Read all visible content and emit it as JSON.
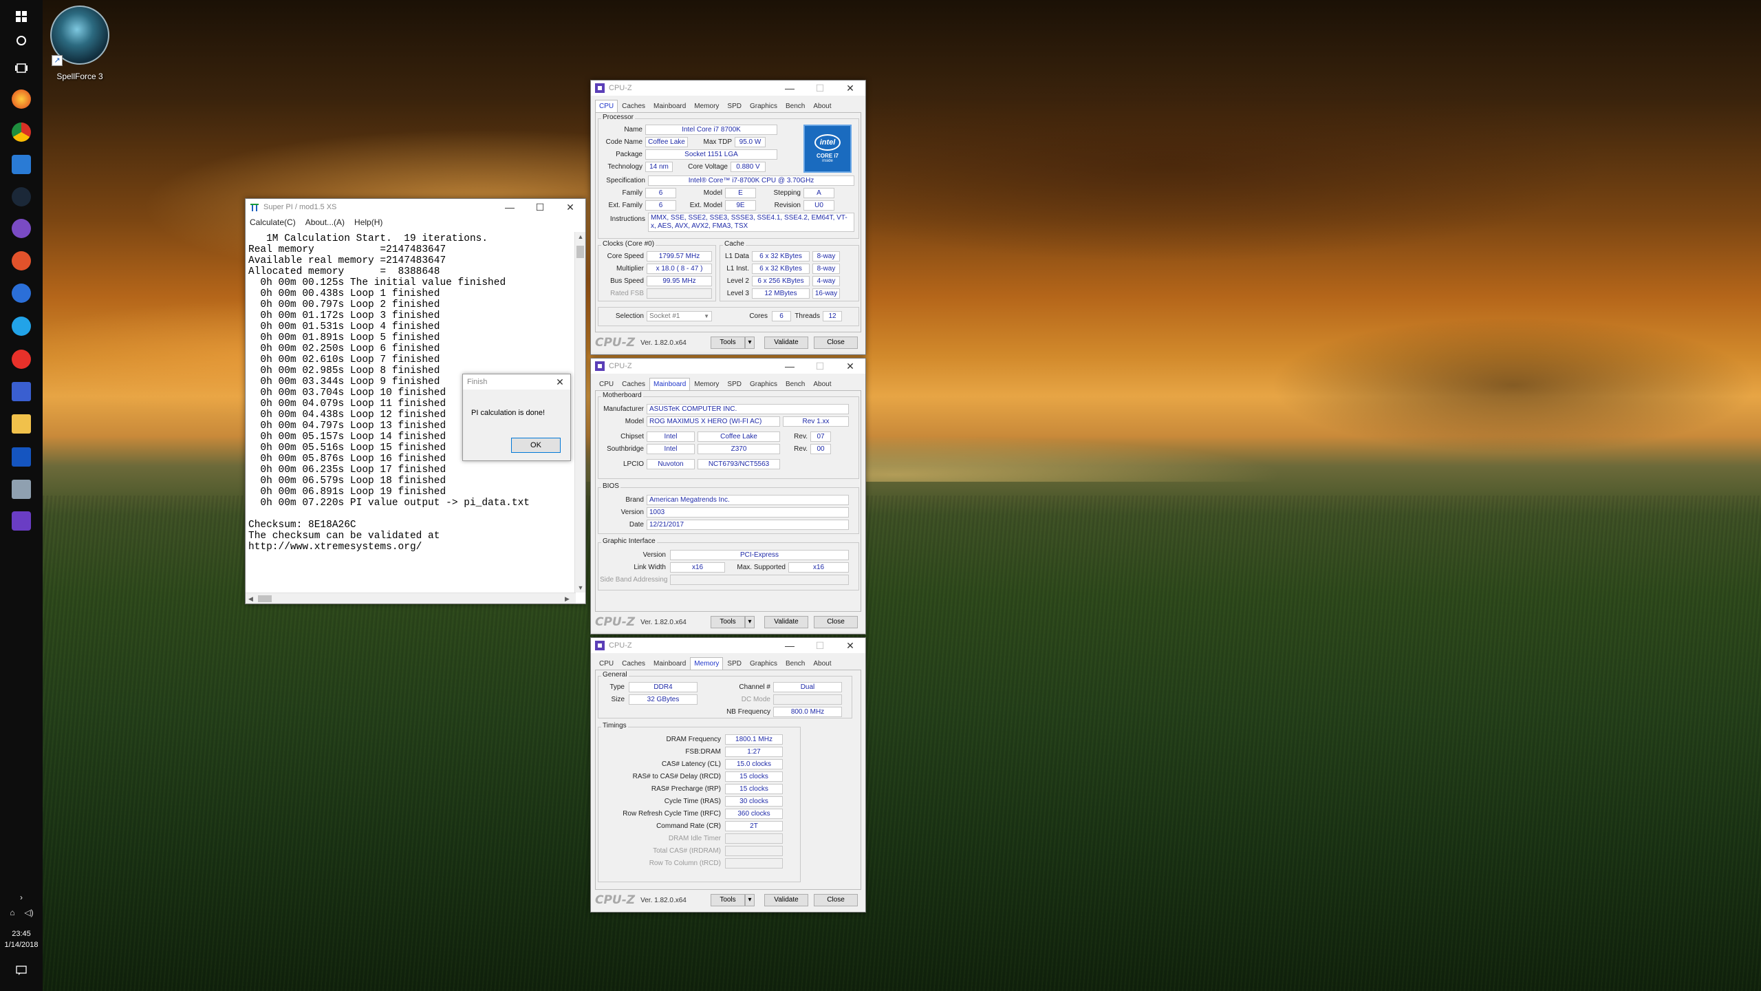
{
  "desktop": {
    "icon_label": "SpellForce 3"
  },
  "taskbar": {
    "time": "23:45",
    "date": "1/14/2018",
    "apps": [
      "windows-start-icon",
      "cortana-icon",
      "task-view-icon",
      "firefox-icon",
      "chrome-icon",
      "app-icon",
      "steam-icon",
      "app-icon",
      "app-icon",
      "app-icon",
      "app-icon",
      "app-icon",
      "app-icon",
      "file-explorer-icon",
      "app-icon",
      "app-icon",
      "cpuz-icon"
    ]
  },
  "superpi": {
    "title": "Super PI / mod1.5 XS",
    "menu": [
      "Calculate(C)",
      "About...(A)",
      "Help(H)"
    ],
    "lines": [
      "   1M Calculation Start.  19 iterations.",
      "Real memory           =2147483647",
      "Available real memory =2147483647",
      "Allocated memory      =  8388648",
      "  0h 00m 00.125s The initial value finished",
      "  0h 00m 00.438s Loop 1 finished",
      "  0h 00m 00.797s Loop 2 finished",
      "  0h 00m 01.172s Loop 3 finished",
      "  0h 00m 01.531s Loop 4 finished",
      "  0h 00m 01.891s Loop 5 finished",
      "  0h 00m 02.250s Loop 6 finished",
      "  0h 00m 02.610s Loop 7 finished",
      "  0h 00m 02.985s Loop 8 finished",
      "  0h 00m 03.344s Loop 9 finished",
      "  0h 00m 03.704s Loop 10 finished",
      "  0h 00m 04.079s Loop 11 finished",
      "  0h 00m 04.438s Loop 12 finished",
      "  0h 00m 04.797s Loop 13 finished",
      "  0h 00m 05.157s Loop 14 finished",
      "  0h 00m 05.516s Loop 15 finished",
      "  0h 00m 05.876s Loop 16 finished",
      "  0h 00m 06.235s Loop 17 finished",
      "  0h 00m 06.579s Loop 18 finished",
      "  0h 00m 06.891s Loop 19 finished",
      "  0h 00m 07.220s PI value output -> pi_data.txt",
      "",
      "Checksum: 8E18A26C",
      "The checksum can be validated at",
      "http://www.xtremesystems.org/"
    ]
  },
  "finish_dialog": {
    "title": "Finish",
    "message": "PI calculation is done!",
    "ok": "OK"
  },
  "cpuz_common": {
    "title": "CPU-Z",
    "tabs": [
      "CPU",
      "Caches",
      "Mainboard",
      "Memory",
      "SPD",
      "Graphics",
      "Bench",
      "About"
    ],
    "brand": "CPU-Z",
    "version": "Ver. 1.82.0.x64",
    "tools": "Tools",
    "validate": "Validate",
    "close": "Close"
  },
  "cpu": {
    "processor_group": "Processor",
    "labels": {
      "name": "Name",
      "codename": "Code Name",
      "maxtdp": "Max TDP",
      "package": "Package",
      "technology": "Technology",
      "corevoltage": "Core Voltage",
      "specification": "Specification",
      "family": "Family",
      "model": "Model",
      "stepping": "Stepping",
      "extfamily": "Ext. Family",
      "extmodel": "Ext. Model",
      "revision": "Revision",
      "instructions": "Instructions"
    },
    "name": "Intel Core i7 8700K",
    "codename": "Coffee Lake",
    "maxtdp": "95.0 W",
    "package": "Socket 1151 LGA",
    "technology": "14 nm",
    "corevoltage": "0.880 V",
    "specification": "Intel® Core™ i7-8700K CPU @ 3.70GHz",
    "family": "6",
    "model": "E",
    "stepping": "A",
    "extfamily": "6",
    "extmodel": "9E",
    "revision": "U0",
    "instructions": "MMX, SSE, SSE2, SSE3, SSSE3, SSE4.1, SSE4.2, EM64T, VT-x, AES, AVX, AVX2, FMA3, TSX",
    "logo": {
      "brand": "intel",
      "line1": "CORE i7",
      "line2": "inside"
    },
    "clocks_group": "Clocks (Core #0)",
    "clock_labels": {
      "corespeed": "Core Speed",
      "multiplier": "Multiplier",
      "busspeed": "Bus Speed",
      "ratedfsb": "Rated FSB"
    },
    "corespeed": "1799.57 MHz",
    "multiplier": "x 18.0 ( 8 - 47 )",
    "busspeed": "99.95 MHz",
    "cache_group": "Cache",
    "cache_labels": {
      "l1d": "L1 Data",
      "l1i": "L1 Inst.",
      "l2": "Level 2",
      "l3": "Level 3"
    },
    "l1d": "6 x 32 KBytes",
    "l1d_way": "8-way",
    "l1i": "6 x 32 KBytes",
    "l1i_way": "8-way",
    "l2": "6 x 256 KBytes",
    "l2_way": "4-way",
    "l3": "12 MBytes",
    "l3_way": "16-way",
    "selection_label": "Selection",
    "selection": "Socket #1",
    "cores_label": "Cores",
    "cores": "6",
    "threads_label": "Threads",
    "threads": "12"
  },
  "mainboard": {
    "mb_group": "Motherboard",
    "labels": {
      "manufacturer": "Manufacturer",
      "model": "Model",
      "chipset": "Chipset",
      "southbridge": "Southbridge",
      "lpcio": "LPCIO",
      "rev": "Rev."
    },
    "manufacturer": "ASUSTeK COMPUTER INC.",
    "model": "ROG MAXIMUS X HERO (WI-FI AC)",
    "model_rev": "Rev 1.xx",
    "chipset_vendor": "Intel",
    "chipset": "Coffee Lake",
    "chipset_rev": "07",
    "sb_vendor": "Intel",
    "southbridge": "Z370",
    "sb_rev": "00",
    "lpcio_vendor": "Nuvoton",
    "lpcio": "NCT6793/NCT5563",
    "bios_group": "BIOS",
    "bios_labels": {
      "brand": "Brand",
      "version": "Version",
      "date": "Date"
    },
    "bios_brand": "American Megatrends Inc.",
    "bios_version": "1003",
    "bios_date": "12/21/2017",
    "gi_group": "Graphic Interface",
    "gi_labels": {
      "version": "Version",
      "linkwidth": "Link Width",
      "maxsupported": "Max. Supported",
      "sideband": "Side Band Addressing"
    },
    "gi_version": "PCI-Express",
    "gi_linkwidth": "x16",
    "gi_maxsupported": "x16"
  },
  "memory": {
    "general_group": "General",
    "labels": {
      "type": "Type",
      "size": "Size",
      "channel": "Channel #",
      "dcmode": "DC Mode",
      "nbfreq": "NB Frequency"
    },
    "type": "DDR4",
    "size": "32 GBytes",
    "channel": "Dual",
    "nbfreq": "800.0 MHz",
    "timings_group": "Timings",
    "timing_labels": {
      "dramfreq": "DRAM Frequency",
      "fsbdram": "FSB:DRAM",
      "cl": "CAS# Latency (CL)",
      "trcd": "RAS# to CAS# Delay (tRCD)",
      "trp": "RAS# Precharge (tRP)",
      "tras": "Cycle Time (tRAS)",
      "trfc": "Row Refresh Cycle Time (tRFC)",
      "cr": "Command Rate (CR)",
      "idle": "DRAM Idle Timer",
      "trdram": "Total CAS# (tRDRAM)",
      "trcd2": "Row To Column (tRCD)"
    },
    "dramfreq": "1800.1 MHz",
    "fsbdram": "1:27",
    "cl": "15.0 clocks",
    "trcd": "15 clocks",
    "trp": "15 clocks",
    "tras": "30 clocks",
    "trfc": "360 clocks",
    "cr": "2T"
  }
}
